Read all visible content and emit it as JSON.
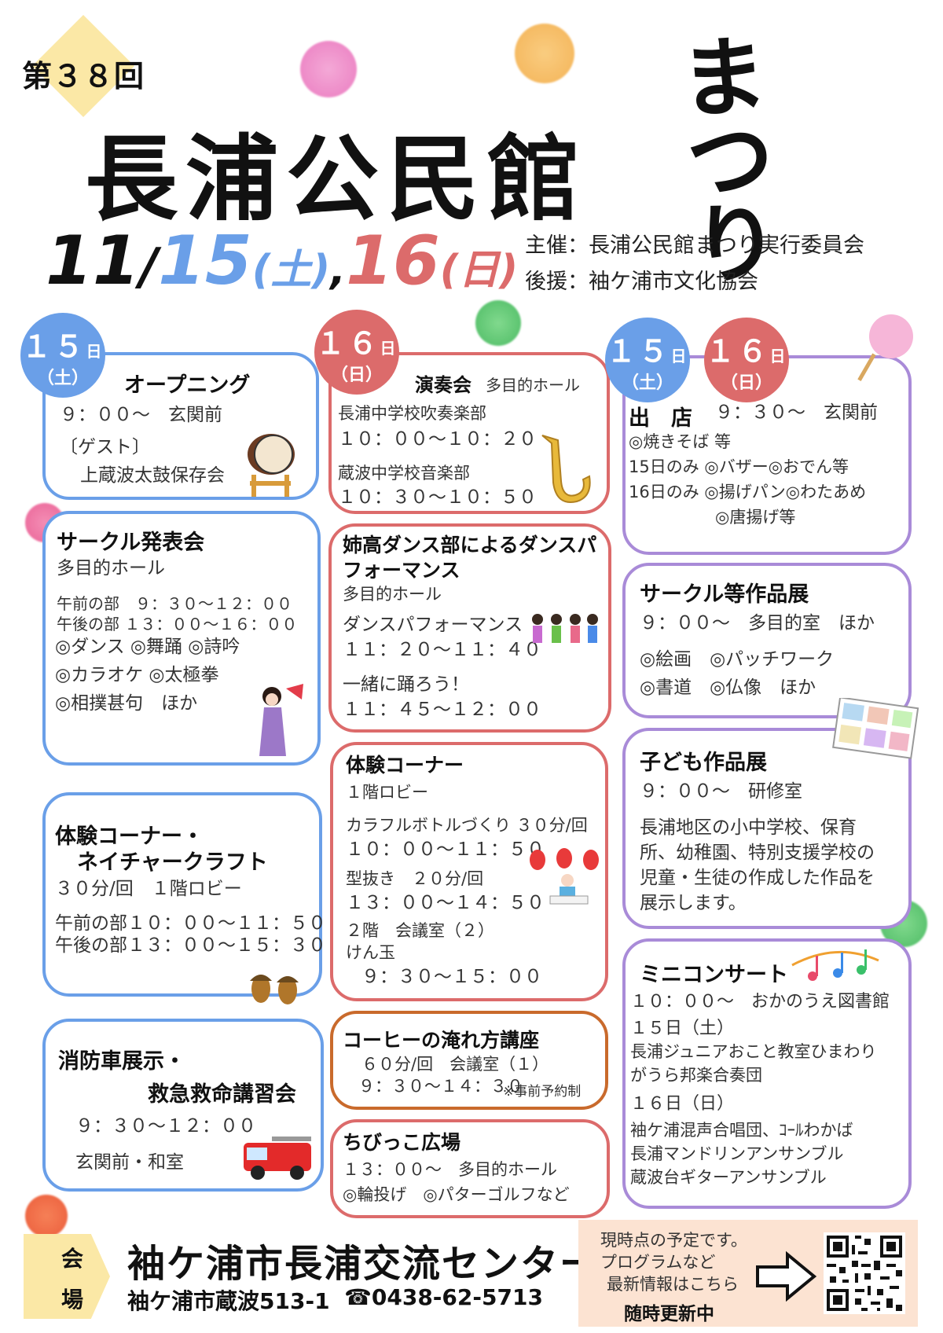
{
  "header": {
    "edition": "第３８回",
    "title": "長浦公民館",
    "title_script": "まつり",
    "date_11": "11",
    "date_slash": "/",
    "date_15": "15",
    "date_15_dow": "(土)",
    "date_sep": ",",
    "date_16": "16",
    "date_16_dow": "(日)",
    "organizer": "主催：長浦公民館まつり実行委員会",
    "supporter": "後援：袖ケ浦市文化協会"
  },
  "badges": {
    "d15": "１５",
    "d16": "１６",
    "day_unit": "日",
    "sat": "（土）",
    "sun": "（日）"
  },
  "col1": {
    "opening": {
      "title": "オープニング",
      "line1": "９：００〜　玄関前",
      "line2": "〔ゲスト〕",
      "line3": "上蔵波太鼓保存会"
    },
    "circle": {
      "title": "サークル発表会",
      "place": "多目的ホール",
      "am": "午前の部　９：３０〜１２：００",
      "pm": "午後の部 １３：００〜１６：００",
      "l1": "◎ダンス ◎舞踊 ◎詩吟",
      "l2": "◎カラオケ ◎太極拳",
      "l3": "◎相撲甚句　ほか"
    },
    "nature": {
      "title1": "体験コーナー・",
      "title2": "ネイチャークラフト",
      "l1": "３０分/回　１階ロビー",
      "l2": "午前の部１０：００〜１１：５０",
      "l3": "午後の部１３：００〜１５：３０"
    },
    "fire": {
      "title1": "消防車展示・",
      "title2": "救急救命講習会",
      "l1": "９：３０〜１２：００",
      "l2": "玄関前・和室"
    }
  },
  "col2": {
    "concert": {
      "title": "演奏会",
      "place": "多目的ホール",
      "l1": "長浦中学校吹奏楽部",
      "l2": "１０：００〜１０：２０",
      "l3": "蔵波中学校音楽部",
      "l4": "１０：３０〜１０：５０"
    },
    "dance": {
      "title1": "姉高ダンス部によるダンスパ",
      "title2": "フォーマンス",
      "place": "多目的ホール",
      "l1": "ダンスパフォーマンス",
      "l2": "１１：２０〜１１：４０",
      "l3": "一緒に踊ろう！",
      "l4": "１１：４５〜１２：００"
    },
    "taiken": {
      "title": "体験コーナー",
      "place": "１階ロビー",
      "l1": "カラフルボトルづくり ３０分/回",
      "l2": "１０：００〜１１：５０",
      "l3": "型抜き　２０分/回",
      "l4": "１３：００〜１４：５０",
      "l5": "２階　会議室（２）",
      "l6": "けん玉",
      "l7": "９：３０〜１５：００"
    },
    "coffee": {
      "title": "コーヒーの淹れ方講座",
      "l1": "６０分/回　会議室（１）",
      "l2": "９：３０〜１４：３０",
      "note": "※事前予約制"
    },
    "kids": {
      "title": "ちびっこ広場",
      "l1": "１３：００〜　多目的ホール",
      "l2": "◎輪投げ　◎パターゴルフなど"
    }
  },
  "col3": {
    "shop": {
      "title": "出　店",
      "time": "９：３０〜　玄関前",
      "l1": "◎焼きそば 等",
      "l2": "15日のみ ◎バザー◎おでん等",
      "l3": "16日のみ ◎揚げパン◎わたあめ",
      "l4": "◎唐揚げ等"
    },
    "works": {
      "title": "サークル等作品展",
      "l1": "９：００〜　多目的室　ほか",
      "l2": "◎絵画　◎パッチワーク",
      "l3": "◎書道　◎仏像　ほか"
    },
    "child": {
      "title": "子ども作品展",
      "l1": "９：００〜　研修室",
      "l2": "長浦地区の小中学校、保育",
      "l3": "所、幼稚園、特別支援学校の",
      "l4": "児童・生徒の作成した作品を",
      "l5": "展示します。"
    },
    "mini": {
      "title": "ミニコンサート",
      "l1": "１０：００〜　おかのうえ図書館",
      "l2": "１５日（土）",
      "l3": "長浦ジュニアおこと教室ひまわり",
      "l4": "がうら邦楽合奏団",
      "l5": "１６日（日）",
      "l6": "袖ケ浦混声合唱団、ｺｰﾙわかば",
      "l7": "長浦マンドリンアンサンブル",
      "l8": "蔵波台ギターアンサンブル"
    }
  },
  "footer": {
    "venue_label1": "会",
    "venue_label2": "場",
    "venue": "袖ケ浦市長浦交流センター",
    "address": "袖ケ浦市蔵波513-1",
    "phone": "☎0438-62-5713",
    "note1": "現時点の予定です。",
    "note2": "プログラムなど",
    "note3": "最新情報はこちら",
    "note4": "随時更新中"
  },
  "colors": {
    "blue": "#6a9fe8",
    "red": "#dc6b6b",
    "purple": "#a98bd8",
    "orange": "#c96a2c"
  }
}
